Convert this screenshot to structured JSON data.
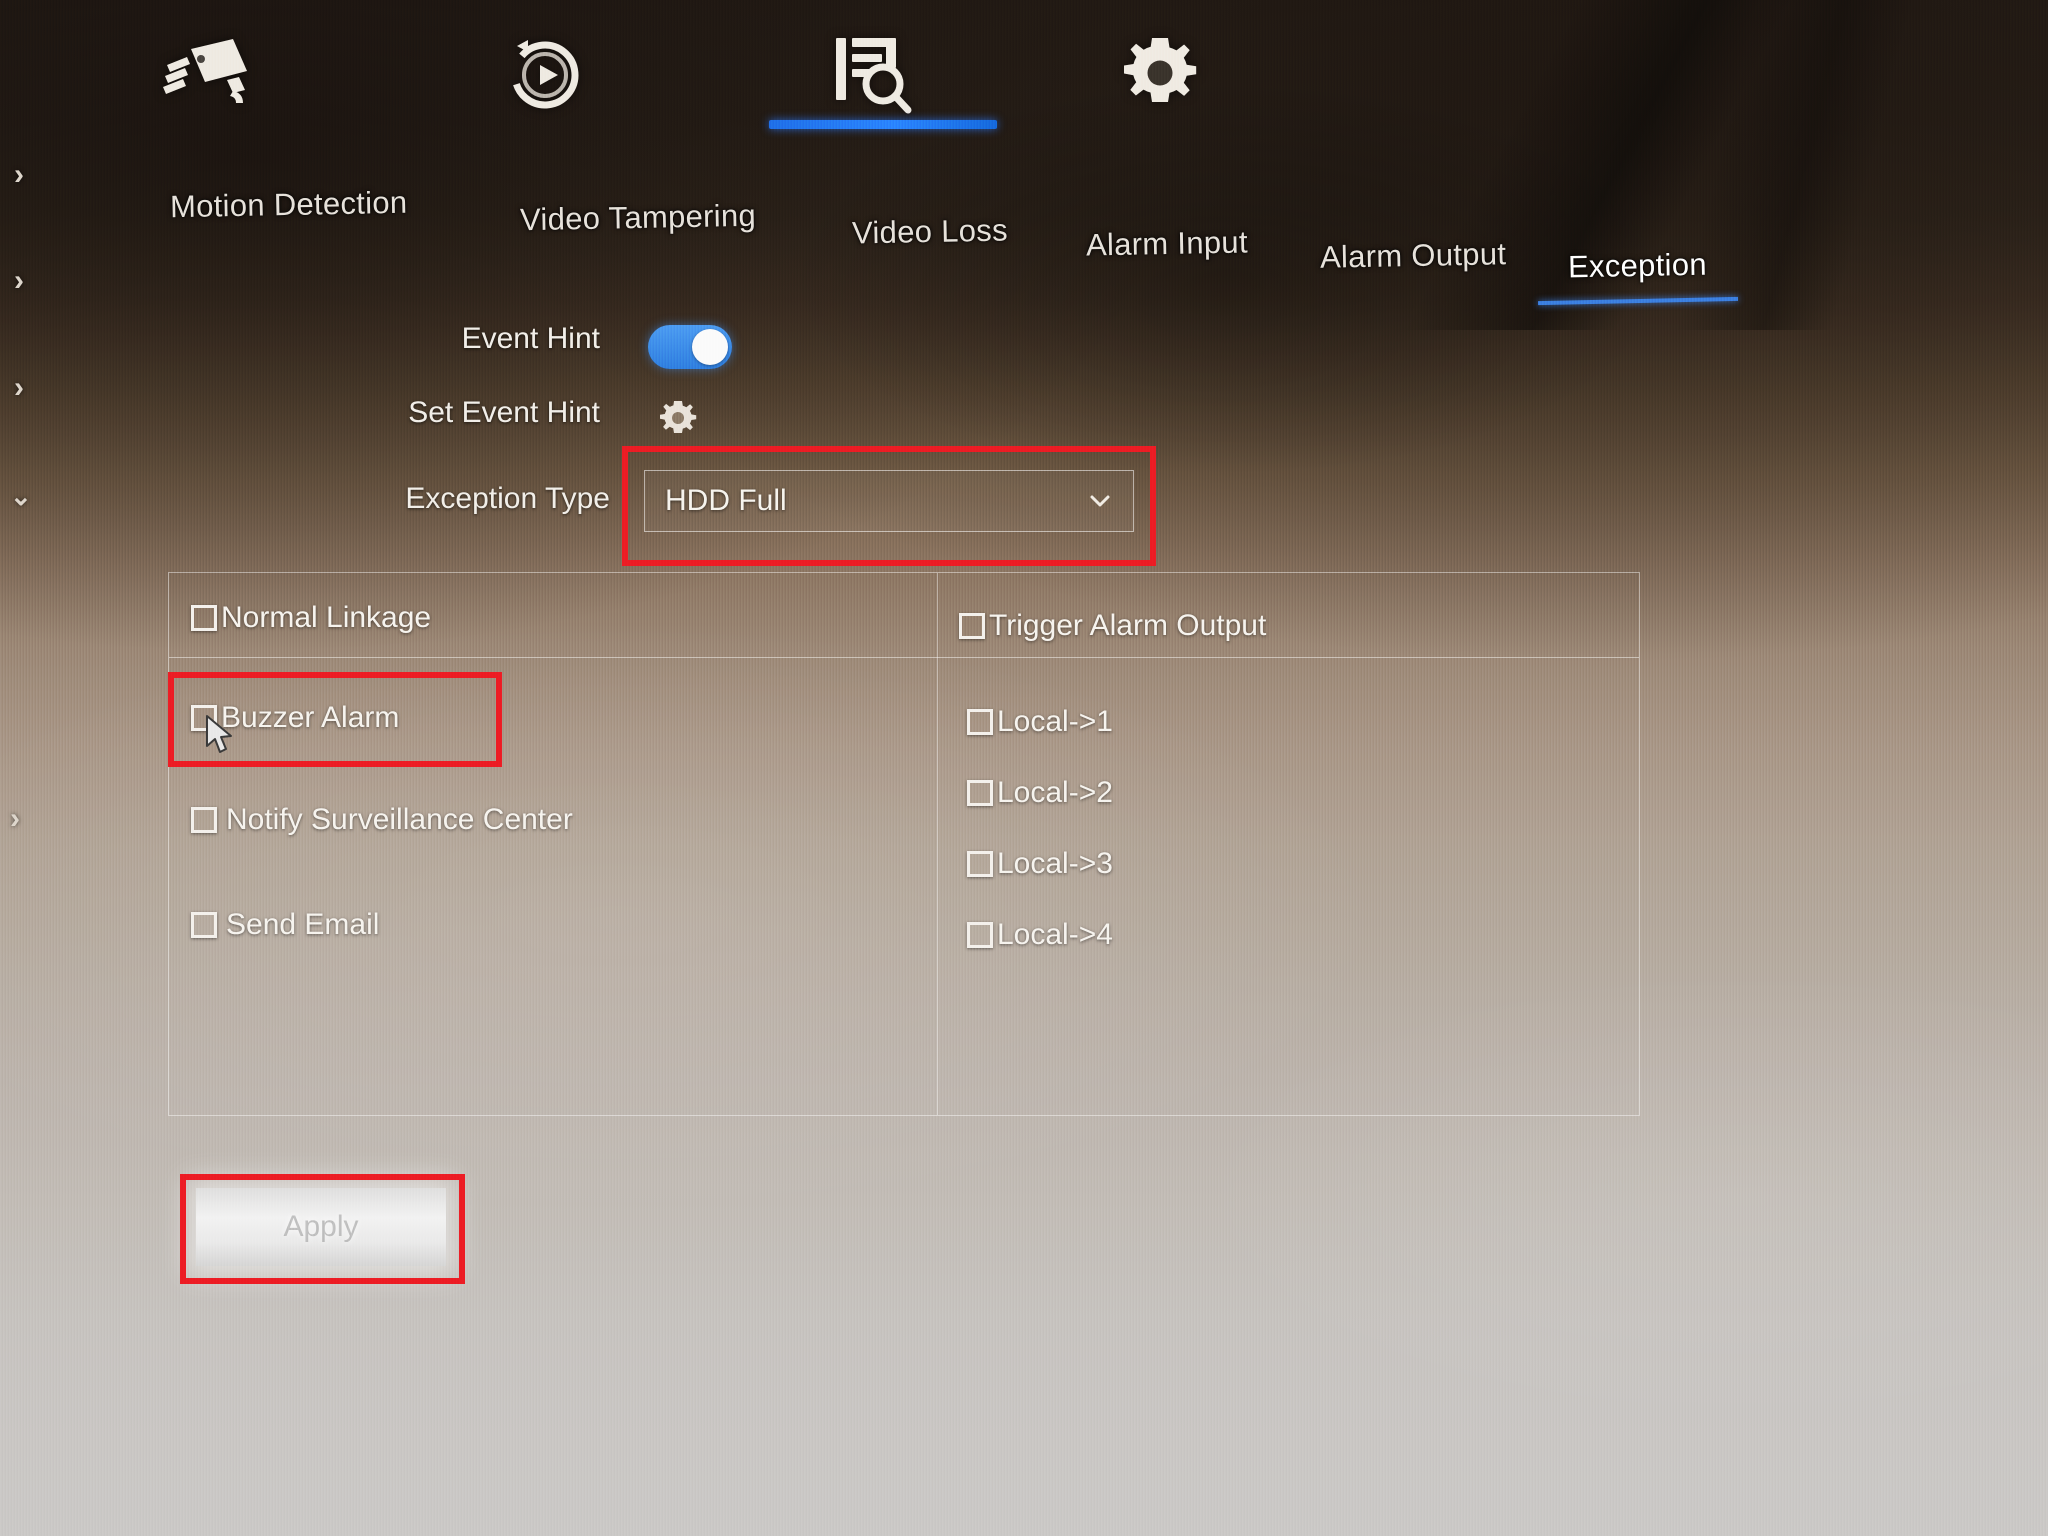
{
  "device": {
    "ui_kind": "nvr-exception-settings"
  },
  "sidebar": {
    "items": [
      {
        "icon": "chevron-right-icon",
        "expanded": false
      },
      {
        "icon": "chevron-right-icon",
        "expanded": false
      },
      {
        "icon": "chevron-right-icon",
        "expanded": false
      },
      {
        "icon": "chevron-down-icon",
        "expanded": true
      },
      {
        "icon": "chevron-right-icon",
        "expanded": false
      }
    ]
  },
  "toolbar": {
    "items": [
      {
        "id": "camera",
        "icon": "camera-icon",
        "active": false
      },
      {
        "id": "playback",
        "icon": "playback-icon",
        "active": false
      },
      {
        "id": "log",
        "icon": "log-search-icon",
        "active": false
      },
      {
        "id": "settings",
        "icon": "gear-icon",
        "active": true
      }
    ],
    "active_index": 3
  },
  "tabs": {
    "items": [
      {
        "label": "Motion Detection",
        "active": false
      },
      {
        "label": "Video Tampering",
        "active": false
      },
      {
        "label": "Video Loss",
        "active": false
      },
      {
        "label": "Alarm Input",
        "active": false
      },
      {
        "label": "Alarm Output",
        "active": false
      },
      {
        "label": "Exception",
        "active": true
      }
    ],
    "active_label": "Exception"
  },
  "form": {
    "event_hint": {
      "label": "Event Hint",
      "value": "on"
    },
    "set_event_hint": {
      "label": "Set Event Hint",
      "icon": "gear-icon"
    },
    "exception_type": {
      "label": "Exception Type",
      "value": "HDD Full",
      "caret": "chevron-down-icon"
    }
  },
  "linkage": {
    "normal": {
      "header": {
        "label": "Normal Linkage",
        "checked": false
      },
      "items": [
        {
          "label": "Buzzer Alarm",
          "checked": false
        },
        {
          "label": "Notify Surveillance Center",
          "checked": false
        },
        {
          "label": "Send Email",
          "checked": false
        }
      ]
    },
    "trigger": {
      "header": {
        "label": "Trigger Alarm Output",
        "checked": false
      },
      "items": [
        {
          "label": "Local->1",
          "checked": false
        },
        {
          "label": "Local->2",
          "checked": false
        },
        {
          "label": "Local->3",
          "checked": false
        },
        {
          "label": "Local->4",
          "checked": false
        }
      ]
    }
  },
  "actions": {
    "apply_label": "Apply"
  },
  "annotations": {
    "accent_red": "#ed1c24",
    "accent_blue": "#2a85ff",
    "boxes": [
      {
        "target": "exception-type-select"
      },
      {
        "target": "buzzer-alarm-row"
      },
      {
        "target": "apply-button"
      }
    ]
  }
}
